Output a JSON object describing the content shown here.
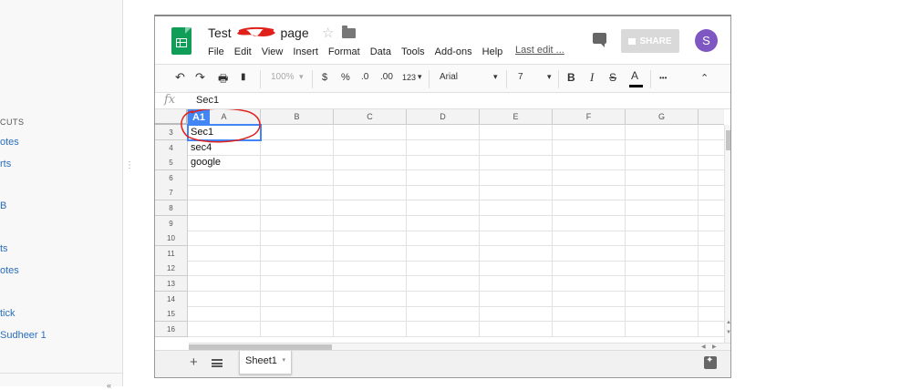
{
  "sidebar": {
    "items": [
      {
        "label": "CUTS",
        "kind": "heading"
      },
      {
        "label": "otes",
        "kind": "link"
      },
      {
        "label": "rts",
        "kind": "link"
      },
      {
        "label": "B",
        "kind": "link"
      },
      {
        "label": "ts",
        "kind": "link"
      },
      {
        "label": "otes",
        "kind": "link"
      },
      {
        "label": "tick",
        "kind": "link"
      },
      {
        "label": "Sudheer 1",
        "kind": "link"
      }
    ],
    "handle": "⋮",
    "collapse": "«"
  },
  "window": {
    "title_before": "Test",
    "title_after": "page",
    "menu": [
      "File",
      "Edit",
      "View",
      "Insert",
      "Format",
      "Data",
      "Tools",
      "Add-ons",
      "Help"
    ],
    "last_edit": "Last edit ...",
    "share_label": "SHARE",
    "avatar_letter": "S",
    "star": "☆"
  },
  "toolbar": {
    "undo": "↶",
    "redo": "↷",
    "print": "🖶",
    "paint_format": "▮",
    "zoom": "100%",
    "currency": "$",
    "percent": "%",
    "decrease_decimals": ".0",
    "increase_decimals": ".00",
    "more_formats": "123",
    "font": "Arial",
    "font_size": "7",
    "bold": "B",
    "italic": "I",
    "strikethrough": "S",
    "text_color": "A",
    "more": "•••",
    "collapse": "⌃",
    "caret": "▾"
  },
  "formula_bar": {
    "fx": "fx",
    "value": "Sec1"
  },
  "grid": {
    "name_box": "A1",
    "columns": [
      "A",
      "B",
      "C",
      "D",
      "E",
      "F",
      "G"
    ],
    "rows": [
      {
        "num": "3",
        "a": "Sec1"
      },
      {
        "num": "4",
        "a": "sec4"
      },
      {
        "num": "5",
        "a": "google"
      },
      {
        "num": "6",
        "a": ""
      },
      {
        "num": "7",
        "a": ""
      },
      {
        "num": "8",
        "a": ""
      },
      {
        "num": "9",
        "a": ""
      },
      {
        "num": "10",
        "a": ""
      },
      {
        "num": "11",
        "a": ""
      },
      {
        "num": "12",
        "a": ""
      },
      {
        "num": "13",
        "a": ""
      },
      {
        "num": "14",
        "a": ""
      },
      {
        "num": "15",
        "a": ""
      },
      {
        "num": "16",
        "a": ""
      }
    ]
  },
  "sheet_tabs": {
    "add": "+",
    "tab_label": "Sheet1",
    "tab_caret": "▾"
  },
  "colors": {
    "sheets_green": "#0f9d58",
    "selection_blue": "#4285f4",
    "avatar_purple": "#7e57c2",
    "annotation_red": "#e0201b"
  }
}
